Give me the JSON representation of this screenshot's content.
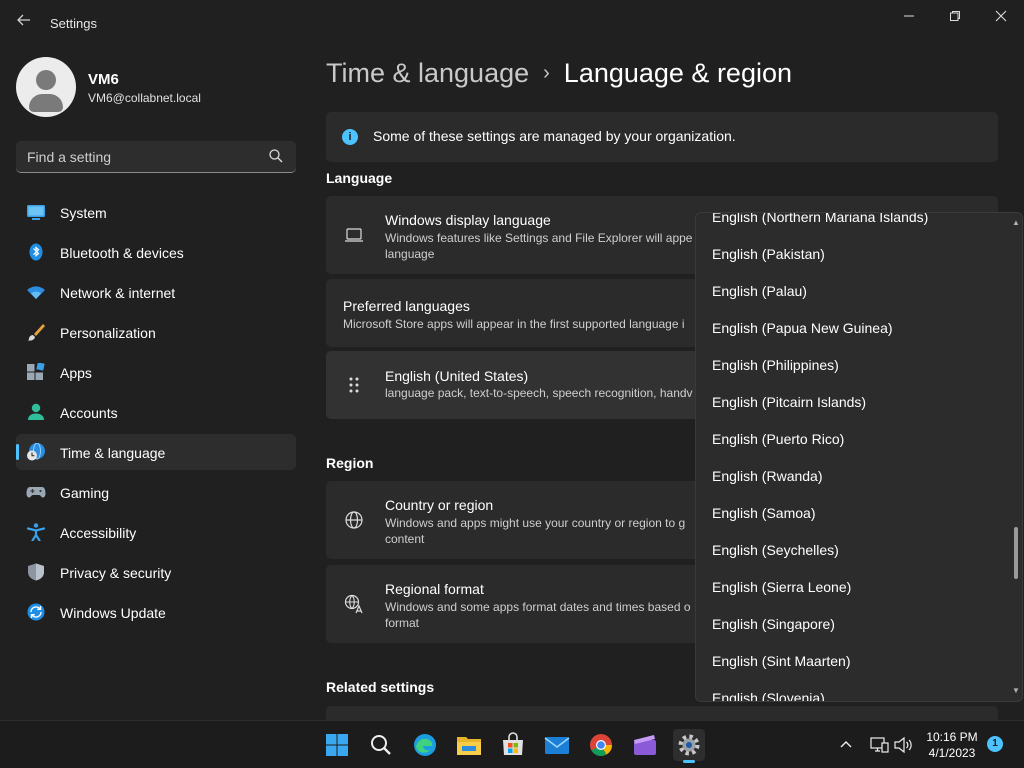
{
  "app": {
    "title": "Settings",
    "back_icon": "arrow-left-icon",
    "window_controls": [
      "minimize-icon",
      "restore-icon",
      "close-icon"
    ]
  },
  "profile": {
    "name": "VM6",
    "email": "VM6@collabnet.local"
  },
  "search": {
    "placeholder": "Find a setting"
  },
  "sidebar": {
    "items": [
      {
        "label": "System",
        "icon": "system-monitor-icon"
      },
      {
        "label": "Bluetooth & devices",
        "icon": "bluetooth-icon"
      },
      {
        "label": "Network & internet",
        "icon": "wifi-icon"
      },
      {
        "label": "Personalization",
        "icon": "paintbrush-icon"
      },
      {
        "label": "Apps",
        "icon": "apps-icon"
      },
      {
        "label": "Accounts",
        "icon": "person-icon"
      },
      {
        "label": "Time & language",
        "icon": "globe-clock-icon",
        "active": true
      },
      {
        "label": "Gaming",
        "icon": "gamepad-icon"
      },
      {
        "label": "Accessibility",
        "icon": "accessibility-icon"
      },
      {
        "label": "Privacy & security",
        "icon": "shield-icon"
      },
      {
        "label": "Windows Update",
        "icon": "update-icon"
      }
    ]
  },
  "breadcrumb": {
    "parent": "Time & language",
    "separator": "›",
    "current": "Language & region"
  },
  "info_banner": {
    "text": "Some of these settings are managed by your organization."
  },
  "language": {
    "heading": "Language",
    "display_language": {
      "title": "Windows display language",
      "desc_line1": "Windows features like Settings and File Explorer will appe",
      "desc_line2": "language"
    },
    "preferred": {
      "title": "Preferred languages",
      "desc": "Microsoft Store apps will appear in the first supported language i"
    },
    "installed": {
      "title": "English (United States)",
      "desc": "language pack, text-to-speech, speech recognition, handv"
    }
  },
  "region": {
    "heading": "Region",
    "country": {
      "title": "Country or region",
      "desc_line1": "Windows and apps might use your country or region to g",
      "desc_line2": "content"
    },
    "format": {
      "title": "Regional format",
      "desc_line1": "Windows and some apps format dates and times based o",
      "desc_line2": "format"
    }
  },
  "related": {
    "heading": "Related settings"
  },
  "dropdown": {
    "items": [
      "English (Northern Mariana Islands)",
      "English (Pakistan)",
      "English (Palau)",
      "English (Papua New Guinea)",
      "English (Philippines)",
      "English (Pitcairn Islands)",
      "English (Puerto Rico)",
      "English (Rwanda)",
      "English (Samoa)",
      "English (Seychelles)",
      "English (Sierra Leone)",
      "English (Singapore)",
      "English (Sint Maarten)",
      "English (Slovenia)"
    ]
  },
  "taskbar": {
    "apps": [
      "windows-start-icon",
      "search-icon",
      "edge-icon",
      "file-explorer-icon",
      "store-icon",
      "mail-icon",
      "chrome-icon",
      "media-app-icon",
      "settings-gear-icon"
    ],
    "time": "10:16 PM",
    "date": "4/1/2023",
    "notification_count": "1"
  },
  "colors": {
    "accent": "#4cc2ff",
    "background": "#202020",
    "card": "#2b2b2b"
  }
}
